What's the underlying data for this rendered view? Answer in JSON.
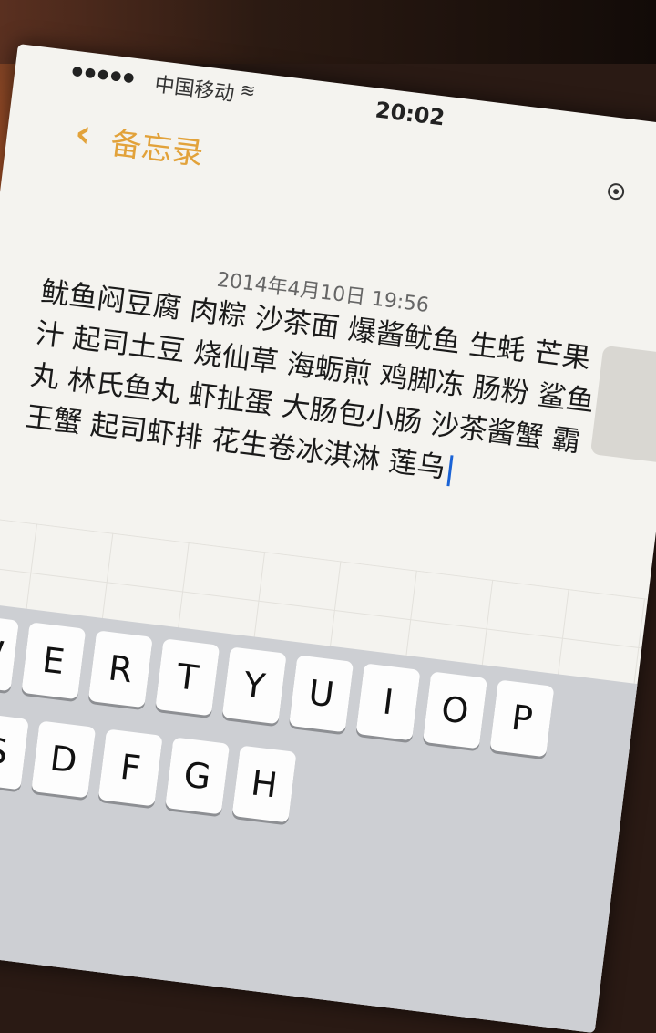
{
  "status_bar": {
    "carrier": "中国移动",
    "time": "20:02"
  },
  "nav": {
    "back_label": "备忘录"
  },
  "note": {
    "date": "2014年4月10日 19:56",
    "body": "鱿鱼闷豆腐 肉粽 沙茶面 爆酱鱿鱼 生蚝 芒果汁 起司土豆 烧仙草 海蛎煎 鸡脚冻 肠粉 鲨鱼丸 林氏鱼丸 虾扯蛋 大肠包小肠 沙茶酱蟹 霸王蟹 起司虾排 花生卷冰淇淋 莲乌"
  },
  "keyboard": {
    "row1": [
      "W",
      "E",
      "R",
      "T",
      "Y",
      "U",
      "I",
      "O",
      "P"
    ],
    "row2": [
      "S",
      "D",
      "F",
      "G",
      "H"
    ]
  }
}
